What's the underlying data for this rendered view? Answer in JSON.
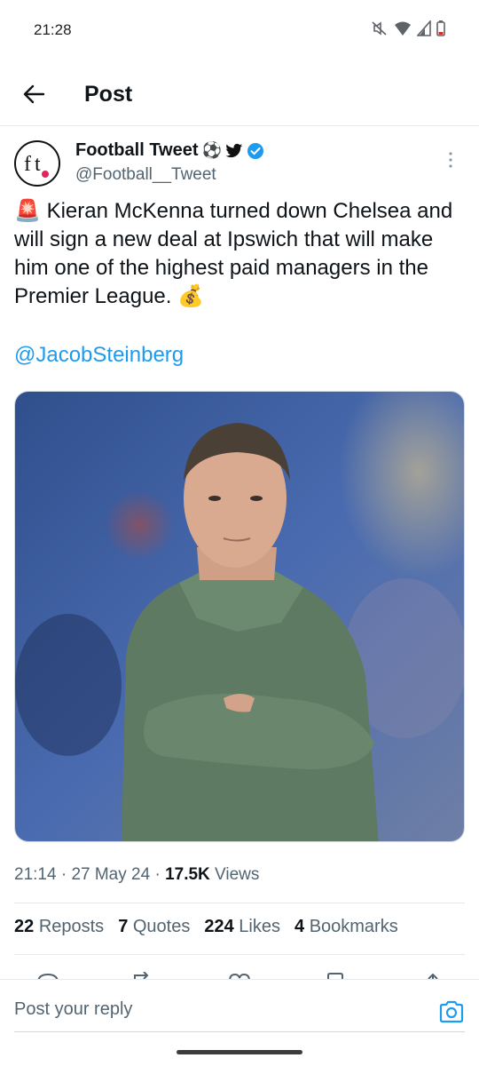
{
  "status_bar": {
    "time": "21:28",
    "icons": [
      "mute-icon",
      "wifi-icon",
      "signal-icon",
      "battery-icon"
    ]
  },
  "header": {
    "title": "Post",
    "back_icon": "back-arrow-icon"
  },
  "author": {
    "name": "Football Tweet",
    "name_emojis": "⚽",
    "handle": "@Football__Tweet",
    "avatar_text": "ft",
    "verified": true
  },
  "tweet": {
    "emoji_alert": "🚨",
    "text": "Kieran McKenna turned down Chelsea and will sign a new deal at Ipswich that will make him one of the highest paid managers in the Premier League.",
    "emoji_money": "💰",
    "mention": "@JacobSteinberg"
  },
  "meta": {
    "time": "21:14",
    "date": "27 May 24",
    "views_count": "17.5K",
    "views_label": "Views"
  },
  "stats": [
    {
      "count": "22",
      "label": "Reposts"
    },
    {
      "count": "7",
      "label": "Quotes"
    },
    {
      "count": "224",
      "label": "Likes"
    },
    {
      "count": "4",
      "label": "Bookmarks"
    }
  ],
  "reply": {
    "placeholder": "Post your reply"
  },
  "colors": {
    "accent": "#1d9bf0",
    "text": "#0f1419",
    "secondary": "#536471"
  }
}
